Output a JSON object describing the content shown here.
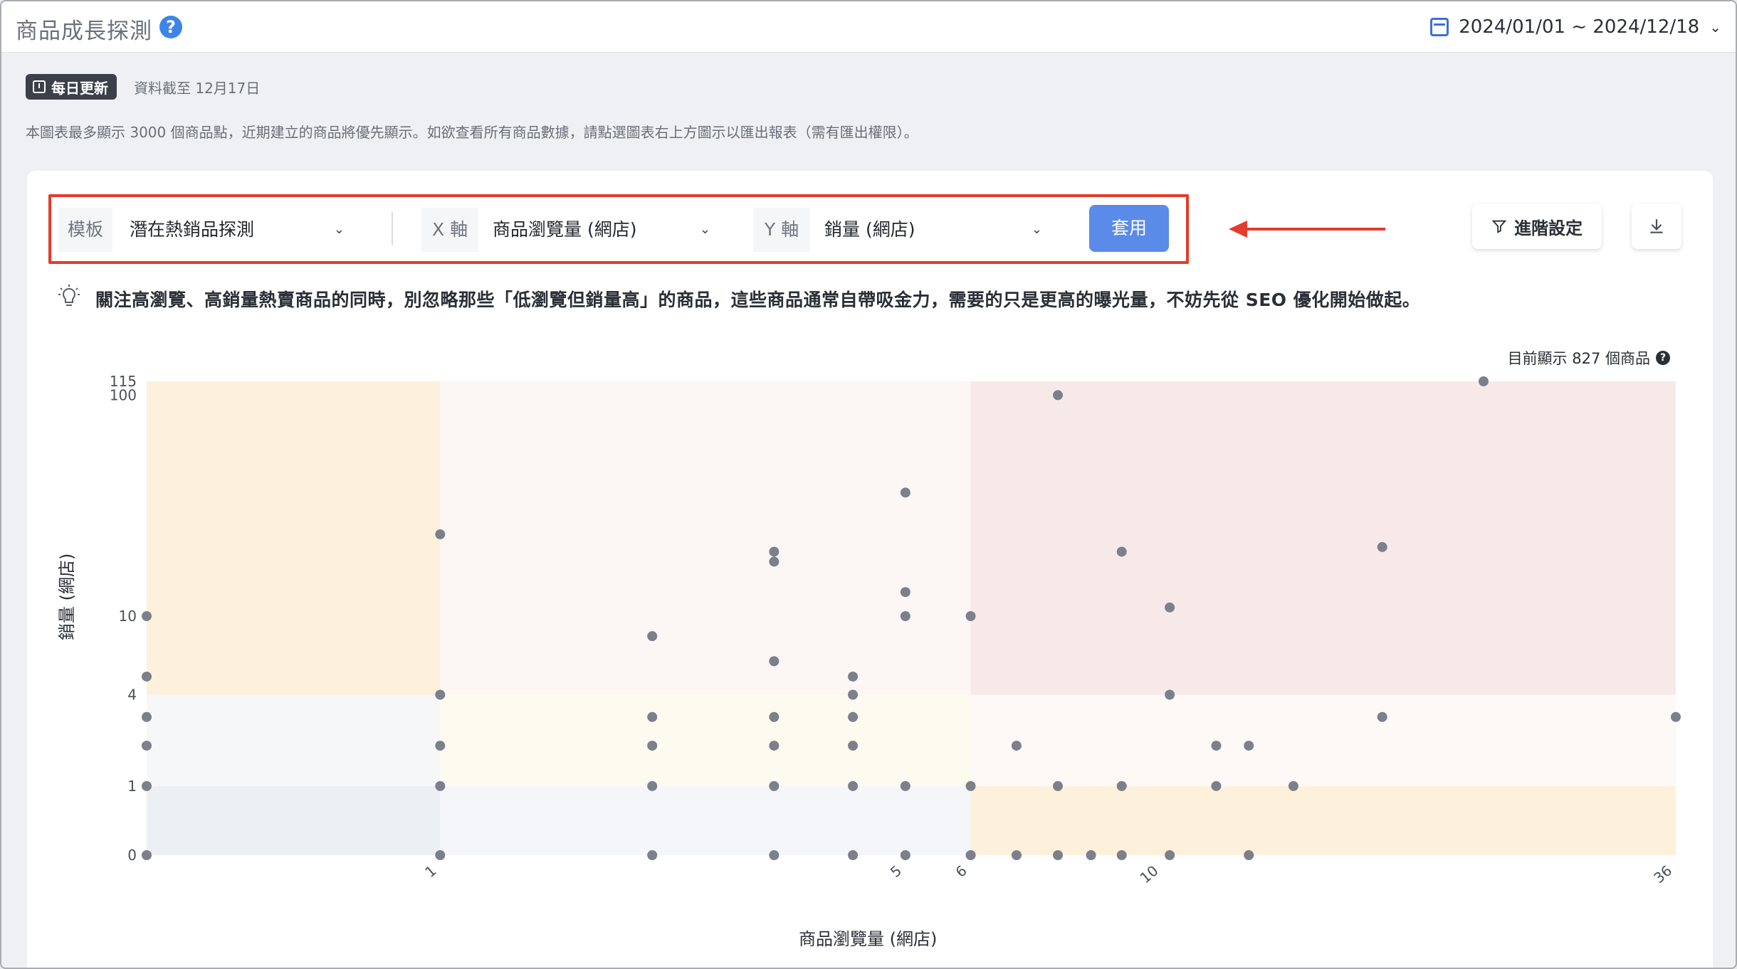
{
  "header": {
    "title": "商品成長探測",
    "date_range": "2024/01/01 ~ 2024/12/18"
  },
  "status": {
    "badge": "每日更新",
    "as_of": "資料截至 12月17日",
    "notice": "本圖表最多顯示 3000 個商品點，近期建立的商品將優先顯示。如欲查看所有商品數據，請點選圖表右上方圖示以匯出報表（需有匯出權限）。"
  },
  "toolbar": {
    "template_label": "模板",
    "template_value": "潛在熱銷品探測",
    "x_label": "X 軸",
    "x_value": "商品瀏覽量 (網店)",
    "y_label": "Y 軸",
    "y_value": "銷量 (網店)",
    "apply_label": "套用",
    "advanced_label": "進階設定"
  },
  "tip": "關注高瀏覽、高銷量熱賣商品的同時，別忽略那些「低瀏覽但銷量高」的商品，這些商品通常自帶吸金力，需要的只是更高的曝光量，不妨先從 SEO 優化開始做起。",
  "count_label": "目前顯示 827 個商品",
  "icons": {
    "help": "question-circle-icon",
    "calendar": "calendar-icon",
    "filter": "filter-icon",
    "download": "download-icon",
    "bulb": "lightbulb-icon"
  },
  "chart_data": {
    "type": "scatter",
    "xlabel": "商品瀏覽量 (網店)",
    "ylabel": "銷量 (網店)",
    "x_scale": "log1p",
    "y_scale": "log1p",
    "xlim": [
      0,
      36
    ],
    "ylim": [
      0,
      115
    ],
    "x_ticks": [
      1,
      5,
      6,
      10,
      36
    ],
    "y_ticks": [
      0,
      1,
      4,
      10,
      100,
      115
    ],
    "x_tick_labels": [
      "1",
      "5",
      "6",
      "10",
      "36"
    ],
    "y_tick_labels": [
      "0",
      "1",
      "4",
      "10",
      "100",
      "115"
    ],
    "grid": false,
    "quadrant_bounds": {
      "x": [
        1,
        6
      ],
      "y": [
        1,
        4
      ]
    },
    "quadrant_colors": {
      "x0y2": "#fdf1dc",
      "x1y2": "#fcf6f5",
      "x2y2": "#f6e9e8",
      "x0y1": "#f6f7f9",
      "x1y1": "#fdfaf0",
      "x2y1": "#fdf9f7",
      "x0y0": "#eceff4",
      "x1y0": "#f4f6f9",
      "x2y0": "#fdf1dc"
    },
    "point_color": "#7b808b",
    "points": [
      [
        0,
        10
      ],
      [
        0,
        5
      ],
      [
        0,
        3
      ],
      [
        0,
        2
      ],
      [
        0,
        1
      ],
      [
        0,
        0
      ],
      [
        1,
        24
      ],
      [
        1,
        4
      ],
      [
        1,
        2
      ],
      [
        1,
        1
      ],
      [
        1,
        0
      ],
      [
        2.3,
        8
      ],
      [
        2.3,
        3
      ],
      [
        2.3,
        2
      ],
      [
        2.3,
        1
      ],
      [
        2.3,
        0
      ],
      [
        3.4,
        20
      ],
      [
        3.4,
        18
      ],
      [
        3.4,
        6
      ],
      [
        3.4,
        3
      ],
      [
        3.4,
        2
      ],
      [
        3.4,
        1
      ],
      [
        3.4,
        0
      ],
      [
        4.3,
        5
      ],
      [
        4.3,
        4
      ],
      [
        4.3,
        3
      ],
      [
        4.3,
        2
      ],
      [
        4.3,
        1
      ],
      [
        4.3,
        0
      ],
      [
        5,
        37
      ],
      [
        5,
        13
      ],
      [
        5,
        10
      ],
      [
        5,
        1
      ],
      [
        5,
        0
      ],
      [
        6,
        10
      ],
      [
        6,
        1
      ],
      [
        6,
        0
      ],
      [
        6.8,
        2
      ],
      [
        6.8,
        0
      ],
      [
        7.6,
        100
      ],
      [
        7.6,
        1
      ],
      [
        7.6,
        0
      ],
      [
        8.3,
        0
      ],
      [
        9,
        20
      ],
      [
        9,
        1
      ],
      [
        9,
        0
      ],
      [
        10.2,
        11
      ],
      [
        10.2,
        4
      ],
      [
        10.2,
        0
      ],
      [
        11.5,
        2
      ],
      [
        11.5,
        1
      ],
      [
        12.5,
        2
      ],
      [
        12.5,
        0
      ],
      [
        14,
        1
      ],
      [
        17.5,
        21
      ],
      [
        17.5,
        3
      ],
      [
        22.5,
        115
      ],
      [
        36,
        3
      ]
    ]
  }
}
